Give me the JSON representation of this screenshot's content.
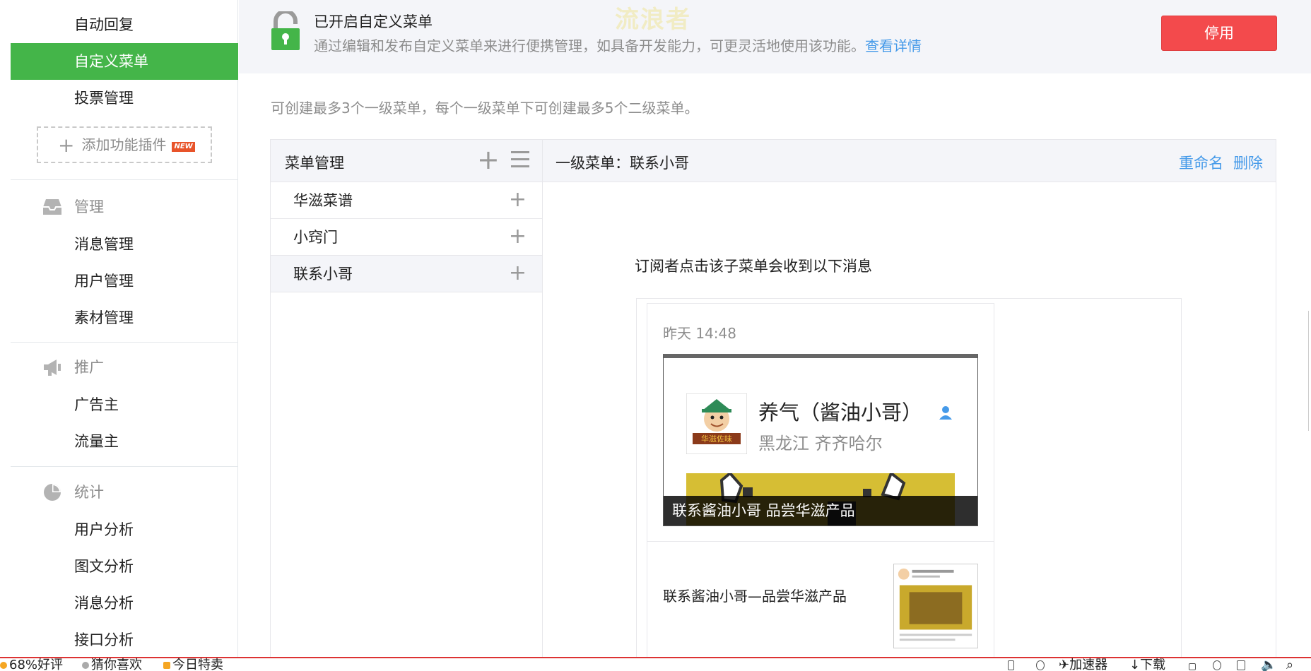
{
  "sidebar": {
    "top_items": [
      "自动回复",
      "自定义菜单",
      "投票管理"
    ],
    "active_item": "自定义菜单",
    "add_plugin": "添加功能插件",
    "new_badge": "NEW",
    "sections": [
      {
        "title": "管理",
        "icon": "inbox-icon",
        "items": [
          "消息管理",
          "用户管理",
          "素材管理"
        ]
      },
      {
        "title": "推广",
        "icon": "megaphone-icon",
        "items": [
          "广告主",
          "流量主"
        ]
      },
      {
        "title": "统计",
        "icon": "pie-chart-icon",
        "items": [
          "用户分析",
          "图文分析",
          "消息分析",
          "接口分析"
        ]
      }
    ]
  },
  "banner": {
    "title": "已开启自定义菜单",
    "desc": "通过编辑和发布自定义菜单来进行便携管理，如具备开发能力，可更灵活地使用该功能。",
    "link": "查看详情",
    "watermark": "流浪者",
    "stop_button": "停用"
  },
  "tip": "可创建最多3个一级菜单，每个一级菜单下可创建最多5个二级菜单。",
  "menu_panel": {
    "title": "菜单管理",
    "items": [
      "华滋菜谱",
      "小窍门",
      "联系小哥"
    ],
    "selected": "联系小哥"
  },
  "detail": {
    "title": "一级菜单：联系小哥",
    "rename": "重命名",
    "delete": "删除",
    "receive_label": "订阅者点击该子菜单会收到以下消息",
    "message": {
      "time": "昨天 14:48",
      "profile_name": "养气（酱油小哥）",
      "profile_location": "黑龙江 齐齐哈尔",
      "avatar_text": "华滋佐味",
      "cover_caption": "联系酱油小哥 品尝华滋产品",
      "sub_title": "联系酱油小哥—品尝华滋产品"
    }
  },
  "statusbar": {
    "rating": "68%好评",
    "guess": "猜你喜欢",
    "deals": "今日特卖",
    "accelerator": "加速器",
    "download": "下载"
  },
  "colors": {
    "accent_green": "#44b549",
    "danger_red": "#f34a4c",
    "link_blue": "#459ae9",
    "panel_bg": "#f4f5f9"
  }
}
